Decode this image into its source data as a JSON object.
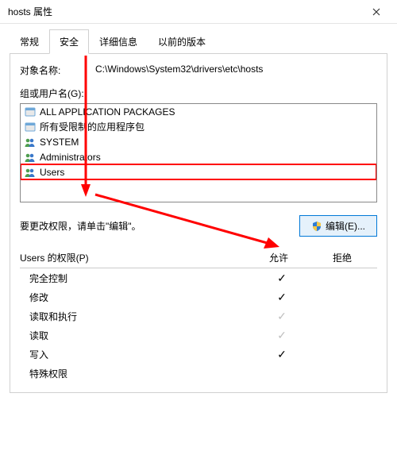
{
  "window": {
    "title": "hosts 属性"
  },
  "tabs": {
    "general": "常规",
    "security": "安全",
    "details": "详细信息",
    "previous": "以前的版本"
  },
  "object_name_label": "对象名称:",
  "object_name_value": "C:\\Windows\\System32\\drivers\\etc\\hosts",
  "groups_label": "组或用户名(G):",
  "groups": {
    "items": [
      {
        "label": "ALL APPLICATION PACKAGES"
      },
      {
        "label": "所有受限制的应用程序包"
      },
      {
        "label": "SYSTEM"
      },
      {
        "label": "Administrators"
      },
      {
        "label": "Users"
      }
    ]
  },
  "edit_hint": "要更改权限，请单击\"编辑\"。",
  "edit_button": "编辑(E)...",
  "perm_title": "Users 的权限(P)",
  "perm_cols": {
    "allow": "允许",
    "deny": "拒绝"
  },
  "perms": [
    {
      "name": "完全控制",
      "allow": "dark",
      "deny": ""
    },
    {
      "name": "修改",
      "allow": "dark",
      "deny": ""
    },
    {
      "name": "读取和执行",
      "allow": "gray",
      "deny": ""
    },
    {
      "name": "读取",
      "allow": "gray",
      "deny": ""
    },
    {
      "name": "写入",
      "allow": "dark",
      "deny": ""
    },
    {
      "name": "特殊权限",
      "allow": "",
      "deny": ""
    }
  ]
}
